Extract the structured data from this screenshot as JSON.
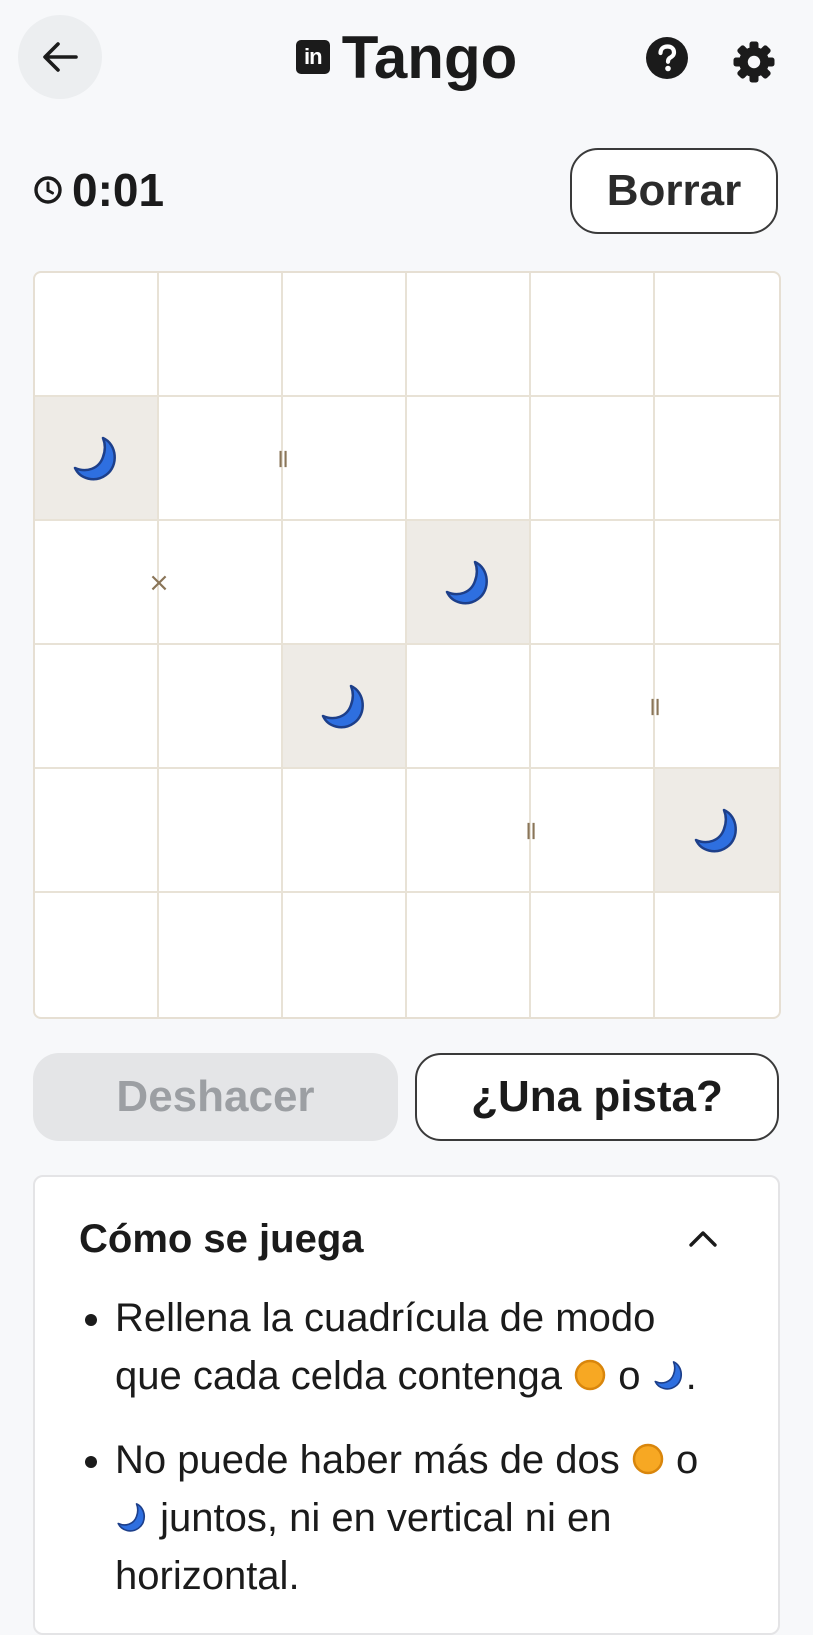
{
  "header": {
    "title": "Tango",
    "logo_text": "in",
    "back_icon": "arrow-left-icon",
    "help_icon": "question-circle-icon",
    "settings_icon": "gear-icon"
  },
  "toolbar": {
    "timer": "0:01",
    "timer_icon": "clock-icon",
    "clear_label": "Borrar"
  },
  "board": {
    "size": 6,
    "cells": [
      [
        "",
        "",
        "",
        "",
        "",
        ""
      ],
      [
        "moon-locked",
        "",
        "",
        "",
        "",
        ""
      ],
      [
        "",
        "",
        "",
        "moon-locked",
        "",
        ""
      ],
      [
        "",
        "",
        "moon-locked",
        "",
        "",
        ""
      ],
      [
        "",
        "",
        "",
        "",
        "",
        "moon-locked"
      ],
      [
        "",
        "",
        "",
        "",
        "",
        ""
      ]
    ],
    "constraints": [
      {
        "row": 1,
        "col": 1,
        "side": "right",
        "symbol": "="
      },
      {
        "row": 2,
        "col": 0,
        "side": "right",
        "symbol": "×"
      },
      {
        "row": 3,
        "col": 4,
        "side": "right",
        "symbol": "="
      },
      {
        "row": 4,
        "col": 3,
        "side": "right",
        "symbol": "="
      }
    ],
    "colors": {
      "moon": "#2e6fe0",
      "sun": "#f7a823",
      "locked_bg": "#eeebe6",
      "marker": "#8a7558"
    }
  },
  "actions": {
    "undo_label": "Deshacer",
    "undo_disabled": true,
    "hint_label": "¿Una pista?"
  },
  "howto": {
    "title": "Cómo se juega",
    "chevron_icon": "chevron-up-icon",
    "rules": [
      {
        "before": "Rellena la cuadrícula de modo que cada celda contenga ",
        "middle": " o ",
        "after": "."
      },
      {
        "before": "No puede haber más de dos ",
        "middle": " o ",
        "after": " juntos, ni en vertical ni en horizontal."
      }
    ]
  }
}
